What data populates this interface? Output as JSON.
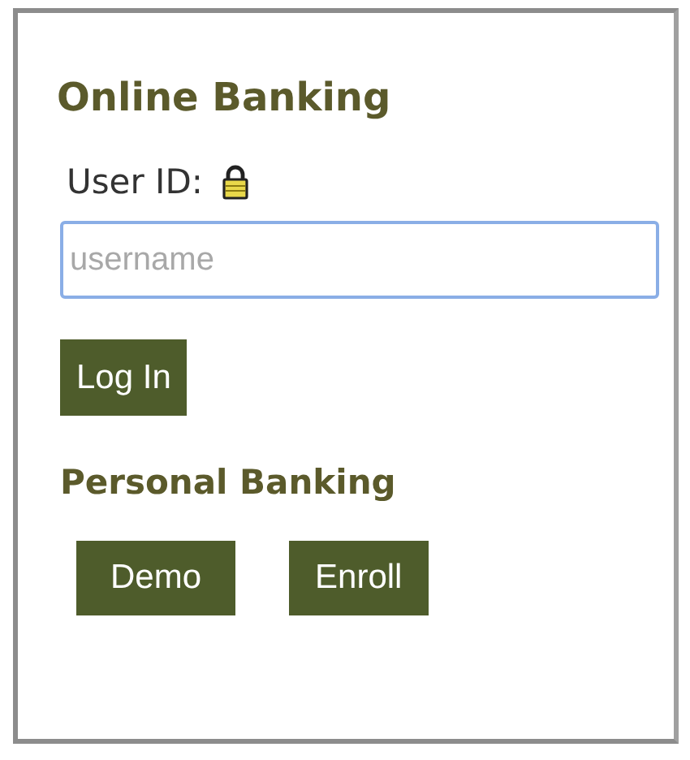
{
  "title": "Online Banking",
  "user_id": {
    "label": "User ID:",
    "placeholder": "username"
  },
  "login_button": "Log In",
  "section": "Personal Banking",
  "buttons": [
    "Demo",
    "Enroll"
  ]
}
